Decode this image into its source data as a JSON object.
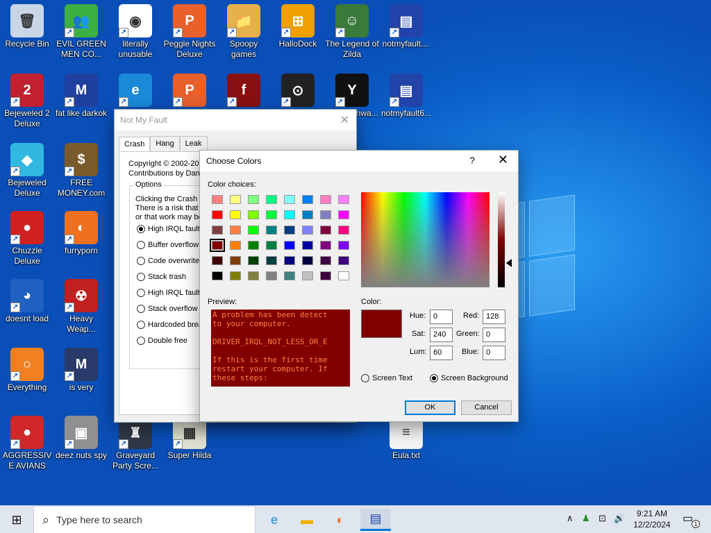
{
  "desktop": {
    "icons": [
      {
        "label": "Recycle Bin",
        "glyph": "🗑",
        "color": "#c8d6e8"
      },
      {
        "label": "EVIL GREEN MEN CO...",
        "glyph": "👥",
        "color": "#3cb043"
      },
      {
        "label": "literally unusable",
        "glyph": "◉",
        "color": "#ffffff"
      },
      {
        "label": "Peggle Nights Deluxe",
        "glyph": "P",
        "color": "#e8602c"
      },
      {
        "label": "Spoopy games",
        "glyph": "📁",
        "color": "#e8b04a"
      },
      {
        "label": "HalloDock",
        "glyph": "⊞",
        "color": "#f0a000"
      },
      {
        "label": "The Legend of Zilda",
        "glyph": "☺",
        "color": "#3a7a3a"
      },
      {
        "label": "notmyfault....",
        "glyph": "▤",
        "color": "#2244aa"
      },
      {
        "label": "Bejeweled 2 Deluxe",
        "glyph": "2",
        "color": "#c02030"
      },
      {
        "label": "fat like darkok",
        "glyph": "M",
        "color": "#2040a0"
      },
      {
        "label": "",
        "glyph": "e",
        "color": "#1a8ad8"
      },
      {
        "label": "",
        "glyph": "P",
        "color": "#e8602c"
      },
      {
        "label": "",
        "glyph": "f",
        "color": "#8a1010"
      },
      {
        "label": "",
        "glyph": "⊙",
        "color": "#222222"
      },
      {
        "label": "...ooo ...nwa...",
        "glyph": "Y",
        "color": "#111111"
      },
      {
        "label": "notmyfault6...",
        "glyph": "▤",
        "color": "#2244aa"
      },
      {
        "label": "Bejeweled Deluxe",
        "glyph": "◆",
        "color": "#30b8e0"
      },
      {
        "label": "FREE MONEY.com",
        "glyph": "$",
        "color": "#7a5a2a"
      },
      {
        "label": "Chuzzle Deluxe",
        "glyph": "●",
        "color": "#d02020"
      },
      {
        "label": "furryporn",
        "glyph": "◐",
        "color": "#f07020"
      },
      {
        "label": "doesnt load",
        "glyph": "◕",
        "color": "#2060c0"
      },
      {
        "label": "Heavy Weap...",
        "glyph": "☢",
        "color": "#c02020"
      },
      {
        "label": "Everything",
        "glyph": "○",
        "color": "#f08020"
      },
      {
        "label": "is very",
        "glyph": "M",
        "color": "#2a3a6a"
      },
      {
        "label": "AGGRESSIVE AVIANS",
        "glyph": "●",
        "color": "#d02828"
      },
      {
        "label": "deez nuts spy",
        "glyph": "▣",
        "color": "#909090"
      },
      {
        "label": "Graveyard Party Scre...",
        "glyph": "♜",
        "color": "#303848"
      },
      {
        "label": "Super Hilda",
        "glyph": "▦",
        "color": "#e0e0d0"
      },
      {
        "label": "Eula.txt",
        "glyph": "≡",
        "color": "#f4f4f4"
      }
    ]
  },
  "not_my_fault": {
    "title": "Not My Fault",
    "close_glyph": "✕",
    "tabs": [
      "Crash",
      "Hang",
      "Leak"
    ],
    "copyright": "Copyright © 2002-20",
    "contributions": "Contributions by Dani",
    "options_title": "Options",
    "desc_lines": [
      "Clicking the Crash b",
      "There is a risk that c",
      "or that work may be"
    ],
    "options": [
      {
        "label": "High IRQL fault (",
        "checked": true
      },
      {
        "label": "Buffer overflow",
        "checked": false
      },
      {
        "label": "Code overwrite",
        "checked": false
      },
      {
        "label": "Stack trash",
        "checked": false
      },
      {
        "label": "High IRQL fault (",
        "checked": false
      },
      {
        "label": "Stack overflow",
        "checked": false
      },
      {
        "label": "Hardcoded breal",
        "checked": false
      },
      {
        "label": "Double free",
        "checked": false
      }
    ]
  },
  "choose_colors": {
    "title": "Choose Colors",
    "help_glyph": "?",
    "close_glyph": "✕",
    "color_choices_label": "Color choices:",
    "swatches": [
      [
        "#ff8080",
        "#ffff80",
        "#80ff80",
        "#00ff80",
        "#80ffff",
        "#0080ff",
        "#ff80c0",
        "#ff80ff"
      ],
      [
        "#ff0000",
        "#ffff00",
        "#80ff00",
        "#00ff40",
        "#00ffff",
        "#0080c0",
        "#8080c0",
        "#ff00ff"
      ],
      [
        "#804040",
        "#ff8040",
        "#00ff00",
        "#008080",
        "#004080",
        "#8080ff",
        "#800040",
        "#ff0080"
      ],
      [
        "#800000",
        "#ff8000",
        "#008000",
        "#008040",
        "#0000ff",
        "#0000a0",
        "#800080",
        "#8000ff"
      ],
      [
        "#400000",
        "#804000",
        "#004000",
        "#004040",
        "#000080",
        "#000040",
        "#400040",
        "#400080"
      ],
      [
        "#000000",
        "#808000",
        "#808040",
        "#808080",
        "#408080",
        "#c0c0c0",
        "#400040",
        "#ffffff"
      ]
    ],
    "selected_swatch": [
      3,
      0
    ],
    "preview_label": "Preview:",
    "preview_text": "A problem has been detect\nto your computer.\n\nDRIVER_IRQL_NOT_LESS_OR_E\n\nIf this is the first time\nrestart your computer. If\nthese steps:",
    "color_label": "Color:",
    "current_color": "#800000",
    "fields": {
      "hue_label": "Hue:",
      "hue": "0",
      "sat_label": "Sat:",
      "sat": "240",
      "lum_label": "Lum:",
      "lum": "60",
      "red_label": "Red:",
      "red": "128",
      "green_label": "Green:",
      "green": "0",
      "blue_label": "Blue:",
      "blue": "0"
    },
    "screen_text_label": "Screen Text",
    "screen_background_label": "Screen Background",
    "screen_background_selected": true,
    "ok_label": "OK",
    "cancel_label": "Cancel"
  },
  "taskbar": {
    "start_glyph": "⊞",
    "search_placeholder": "Type here to search",
    "search_glyph": "⌕",
    "apps": [
      {
        "name": "edge",
        "glyph": "e",
        "color": "#1a8ad8",
        "active": false
      },
      {
        "name": "file-explorer",
        "glyph": "▬",
        "color": "#f0b000",
        "active": false
      },
      {
        "name": "firefox",
        "glyph": "◐",
        "color": "#f07020",
        "active": false
      },
      {
        "name": "notmyfault",
        "glyph": "▤",
        "color": "#2244aa",
        "active": true
      }
    ],
    "tray_chevron": "∧",
    "tray_people": "♟",
    "tray_network": "⊡",
    "tray_volume": "🔊",
    "time": "9:21 AM",
    "date": "12/2/2024",
    "notification_glyph": "▭",
    "notification_count": "1"
  }
}
